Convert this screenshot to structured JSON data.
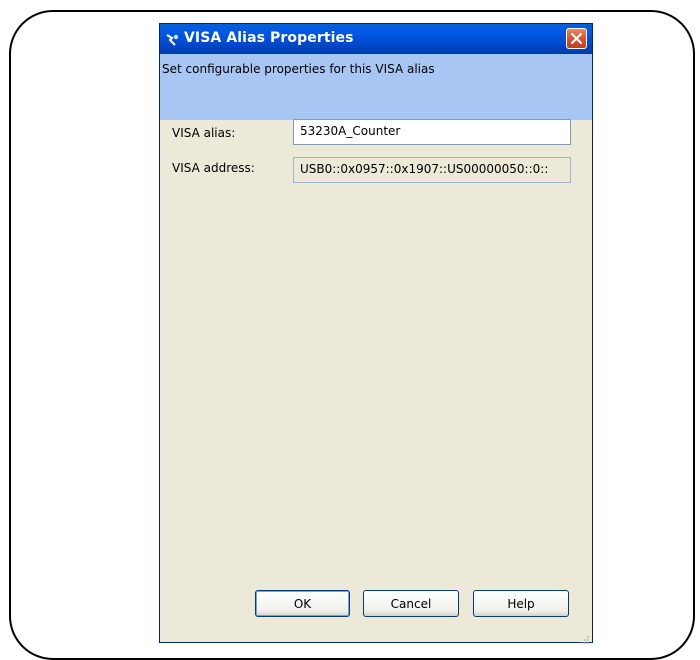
{
  "window": {
    "title": "VISA Alias Properties",
    "description": "Set configurable properties for this VISA alias"
  },
  "fields": {
    "alias_label": "VISA alias:",
    "alias_value": "53230A_Counter",
    "address_label": "VISA address:",
    "address_value": "USB0::0x0957::0x1907::US00000050::0::"
  },
  "buttons": {
    "ok": "OK",
    "cancel": "Cancel",
    "help": "Help"
  },
  "colors": {
    "titlebar": "#0058e6",
    "header_band": "#a7c6f4",
    "dialog_bg": "#ece9d8",
    "close_button": "#d9542c"
  },
  "icons": {
    "title": "visa-properties-icon",
    "close": "close-icon",
    "grip": "resize-grip-icon"
  }
}
